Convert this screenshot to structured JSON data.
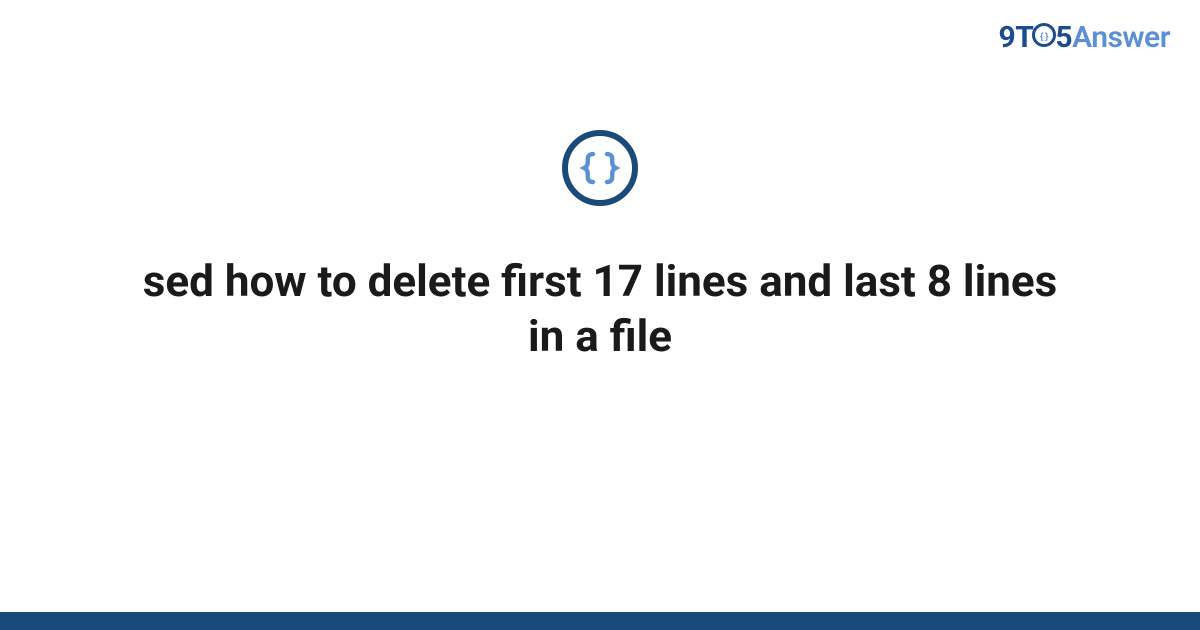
{
  "brand": {
    "part_9t": "9T",
    "part_5": "5",
    "part_answer": "Answer"
  },
  "icon": {
    "name": "code-braces-icon"
  },
  "question": {
    "title": "sed how to delete first 17 lines and last 8 lines in a file"
  },
  "colors": {
    "brand_dark": "#194a7a",
    "brand_light": "#5b8fd6"
  }
}
